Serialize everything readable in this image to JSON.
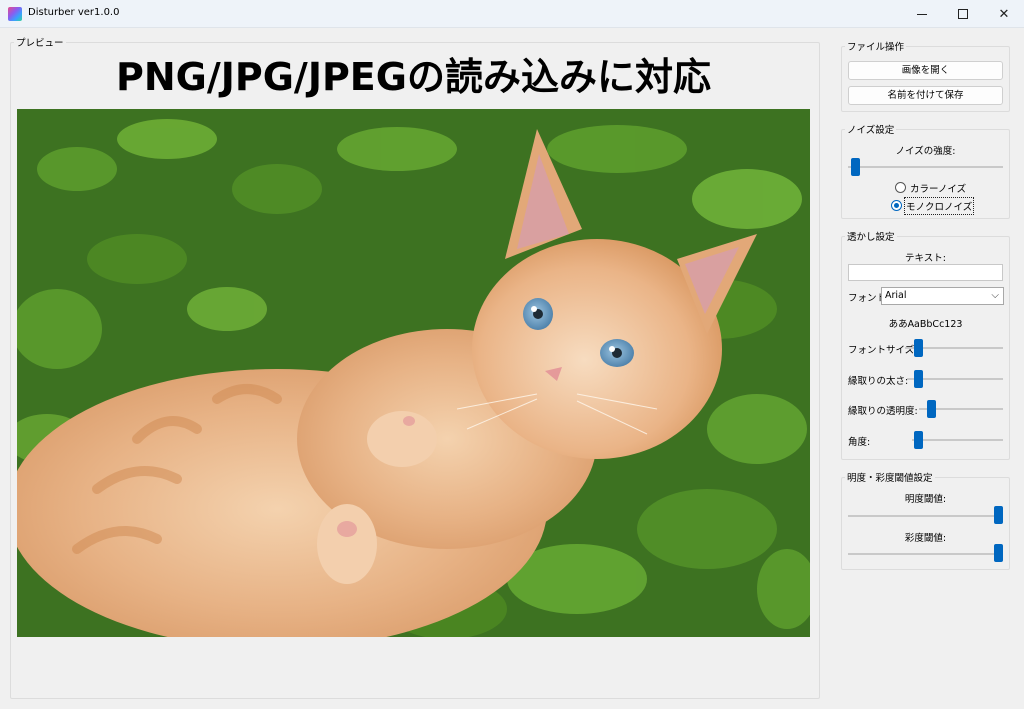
{
  "window": {
    "title": "Disturber ver1.0.0"
  },
  "preview": {
    "legend": "プレビュー",
    "headline": "PNG/JPG/JPEGの読み込みに対応"
  },
  "file_ops": {
    "legend": "ファイル操作",
    "open_label": "画像を開く",
    "save_as_label": "名前を付けて保存"
  },
  "noise": {
    "legend": "ノイズ設定",
    "strength_label": "ノイズの強度:",
    "strength_value": 0.02,
    "options": [
      "カラーノイズ",
      "モノクロノイズ"
    ],
    "selected": "モノクロノイズ"
  },
  "watermark": {
    "legend": "透かし設定",
    "text_label": "テキスト:",
    "text_value": "",
    "font_label": "フォント:",
    "font_value": "Arial",
    "font_sample": "ああAaBbCc123",
    "font_size_label": "フォントサイズ:",
    "font_size_value": 0.1,
    "outline_width_label": "縁取りの太さ:",
    "outline_width_value": 0.08,
    "outline_opacity_label": "縁取りの透明度:",
    "outline_opacity_value": 0.1,
    "angle_label": "角度:",
    "angle_value": 0.02
  },
  "threshold": {
    "legend": "明度・彩度閾値設定",
    "brightness_label": "明度閾値:",
    "brightness_value": 1.0,
    "saturation_label": "彩度閾値:",
    "saturation_value": 1.0
  }
}
